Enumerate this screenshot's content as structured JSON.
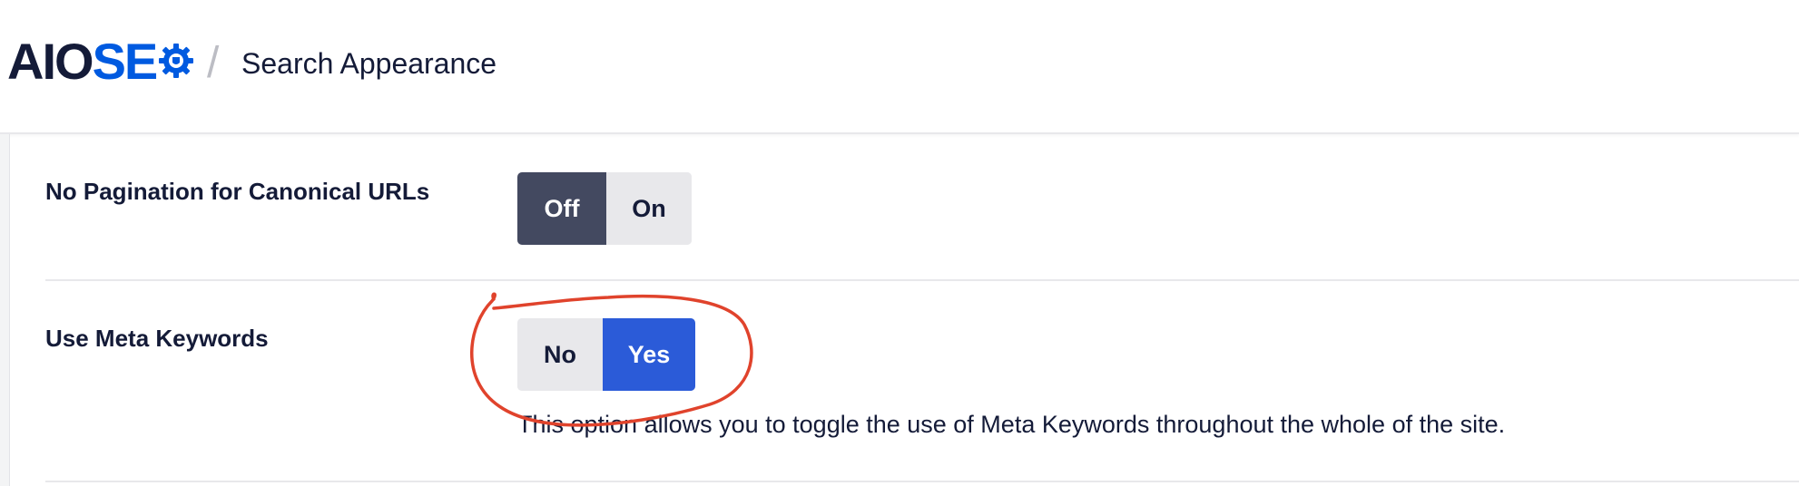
{
  "header": {
    "logo_part1": "AIO",
    "logo_part2": "SE",
    "separator": "/",
    "page_title": "Search Appearance"
  },
  "settings": [
    {
      "label": "No Pagination for Canonical URLs",
      "options": [
        "Off",
        "On"
      ],
      "selected": "Off"
    },
    {
      "label": "Use Meta Keywords",
      "options": [
        "No",
        "Yes"
      ],
      "selected": "Yes",
      "description": "This option allows you to toggle the use of Meta Keywords throughout the whole of the site."
    }
  ],
  "colors": {
    "brand_dark": "#141b38",
    "brand_blue": "#005ae0",
    "toggle_off_active": "#434960",
    "toggle_yes_active": "#2b5bd8",
    "annotation_red": "#e0432c"
  },
  "icons": [
    "gear-icon"
  ]
}
